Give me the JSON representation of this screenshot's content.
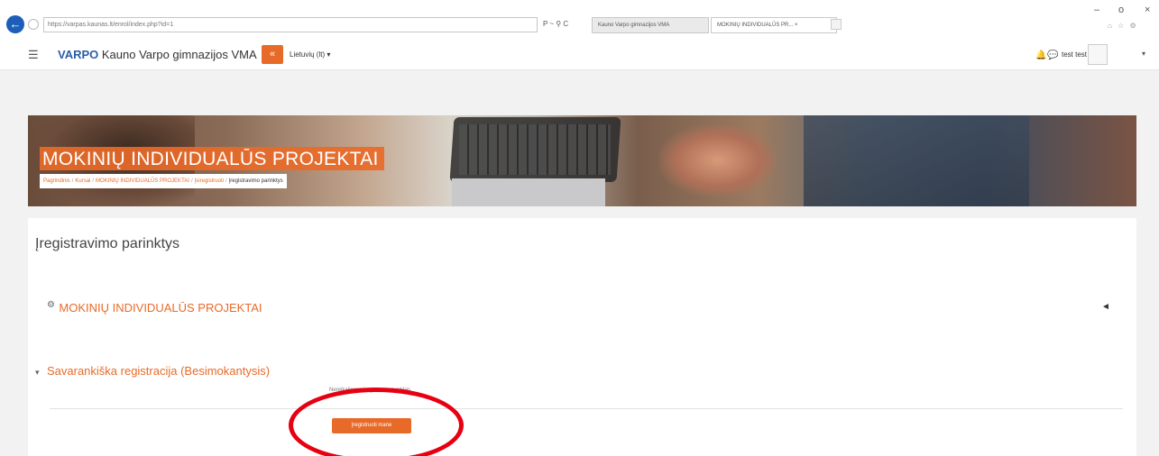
{
  "browser": {
    "address": "https://varpas.kaunas.lt/enrol/index.php?id=1",
    "address_tools": "P ~ ⚲ C",
    "tabs": [
      {
        "label": "Kauno Varpo gimnazijos VMA"
      },
      {
        "label": "MOKINIŲ INDIVIDUALŪS PR... ×"
      }
    ],
    "window_controls": {
      "minimize": "–",
      "maximize": "o",
      "close": "×"
    },
    "icons": [
      "back-arrow-icon",
      "forward-icon",
      "home-icon",
      "star-icon",
      "gear-icon"
    ]
  },
  "navbar": {
    "menu_icon": "☰",
    "logo": "VARPO",
    "site_name": "Kauno Varpo gimnazijos VMA",
    "share_icon": "«",
    "language": "Lietuvių (lt) ▾",
    "user_name": "test test",
    "user_caret": "▾"
  },
  "banner": {
    "title": "MOKINIŲ INDIVIDUALŪS PROJEKTAI",
    "breadcrumb": [
      {
        "label": "Pagrindinis"
      },
      {
        "label": "Kursai"
      },
      {
        "label": "MOKINIŲ INDIVIDUALŪS PROJEKTAI"
      },
      {
        "label": "Įsiregistruoti"
      },
      {
        "label": "Įregistravimo parinktys"
      }
    ],
    "separator": "/"
  },
  "main": {
    "title": "Įregistravimo parinktys",
    "course_name": "MOKINIŲ INDIVIDUALŪS PROJEKTAI",
    "section_caret": "▾",
    "section_title": "Savarankiška registracija (Besimokantysis)",
    "key_note": "Nereikalingas įregistravimo raktas",
    "enrol_button": "Įregistruoti mane"
  },
  "colors": {
    "accent": "#e86a29",
    "annotation_ring": "#e60012"
  }
}
